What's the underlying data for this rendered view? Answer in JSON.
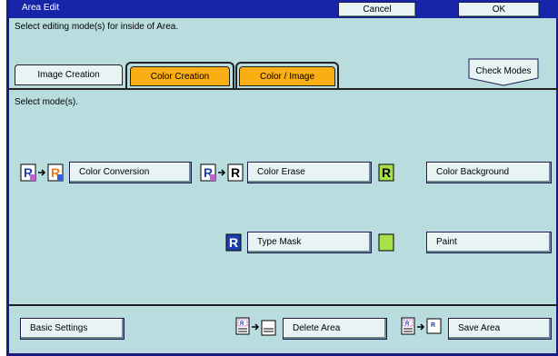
{
  "window": {
    "title": "Area Edit"
  },
  "header": {
    "cancel_label": "Cancel",
    "ok_label": "OK"
  },
  "instruction": "Select editing mode(s) for inside of Area.",
  "tabs": [
    {
      "label": "Image Creation",
      "active": false
    },
    {
      "label": "Color Creation",
      "active": true
    },
    {
      "label": "Color / Image",
      "active": false
    }
  ],
  "check_modes_label": "Check Modes",
  "select_mode_text": "Select mode(s).",
  "modes": {
    "color_conversion": "Color Conversion",
    "color_erase": "Color Erase",
    "color_background": "Color Background",
    "type_mask": "Type Mask",
    "paint": "Paint"
  },
  "icon_glyph": "R",
  "footer": {
    "basic_settings": "Basic Settings",
    "delete_area": "Delete Area",
    "save_area": "Save Area"
  },
  "colors": {
    "title_bar": "#1726a8",
    "screen_bg": "#b9dcdf",
    "tab_active": "#f9ae13",
    "green_swatch": "#a8e04a",
    "icon_blue": "#1c3fb0"
  }
}
